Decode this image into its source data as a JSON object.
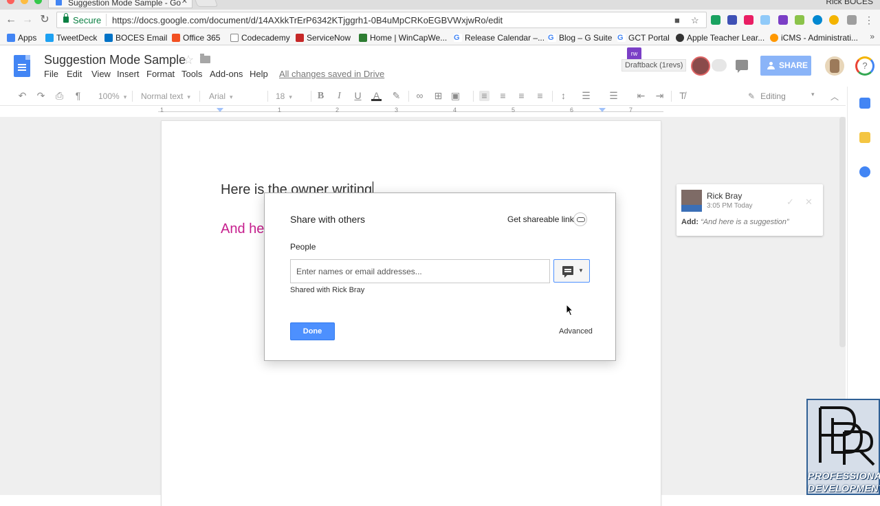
{
  "browser": {
    "tab_title": "Suggestion Mode Sample - Go",
    "profile_name": "Rick BOCES",
    "secure_label": "Secure",
    "url": "https://docs.google.com/document/d/14AXkkTrErP6342KTjggrh1-0B4uMpCRKoEGBVWxjwRo/edit",
    "bookmarks": [
      "Apps",
      "TweetDeck",
      "BOCES Email",
      "Office 365",
      "Codecademy",
      "ServiceNow",
      "Home | WinCapWe...",
      "Release Calendar –...",
      "Blog – G Suite",
      "GCT Portal",
      "Apple Teacher Lear...",
      "iCMS - Administrati..."
    ],
    "bookmark_more": "»"
  },
  "docs": {
    "title": "Suggestion Mode Sample",
    "menu": [
      "File",
      "Edit",
      "View",
      "Insert",
      "Format",
      "Tools",
      "Add-ons",
      "Help"
    ],
    "saved_status": "All changes saved in Drive",
    "draftback_label": "Draftback (1revs)",
    "draftback_icon_text": "rw",
    "share_label": "SHARE",
    "help_label": "?"
  },
  "format_toolbar": {
    "zoom": "100%",
    "style": "Normal text",
    "font": "Arial",
    "size": "18",
    "mode": "Editing"
  },
  "ruler": {
    "numbers": [
      "1",
      "1",
      "2",
      "3",
      "4",
      "5",
      "6",
      "7"
    ]
  },
  "document": {
    "line1": "Here is the owner writing",
    "line2": "And he"
  },
  "suggestion": {
    "author": "Rick Bray",
    "time": "3:05 PM Today",
    "action": "Add:",
    "text": "“And here is a suggestion”",
    "accept_icon": "✓",
    "reject_icon": "✕"
  },
  "share_dialog": {
    "title": "Share with others",
    "shareable_link": "Get shareable link",
    "people_label": "People",
    "input_placeholder": "Enter names or email addresses...",
    "shared_with": "Shared with Rick Bray",
    "done_label": "Done",
    "advanced_label": "Advanced"
  },
  "watermark": {
    "line1": "PROFESSIONAL",
    "line2": "DEVELOPMENT"
  },
  "colors": {
    "suggestion_text": "#c61e8d",
    "primary_button": "#4d90fe",
    "share_button": "#8ab4f8"
  }
}
